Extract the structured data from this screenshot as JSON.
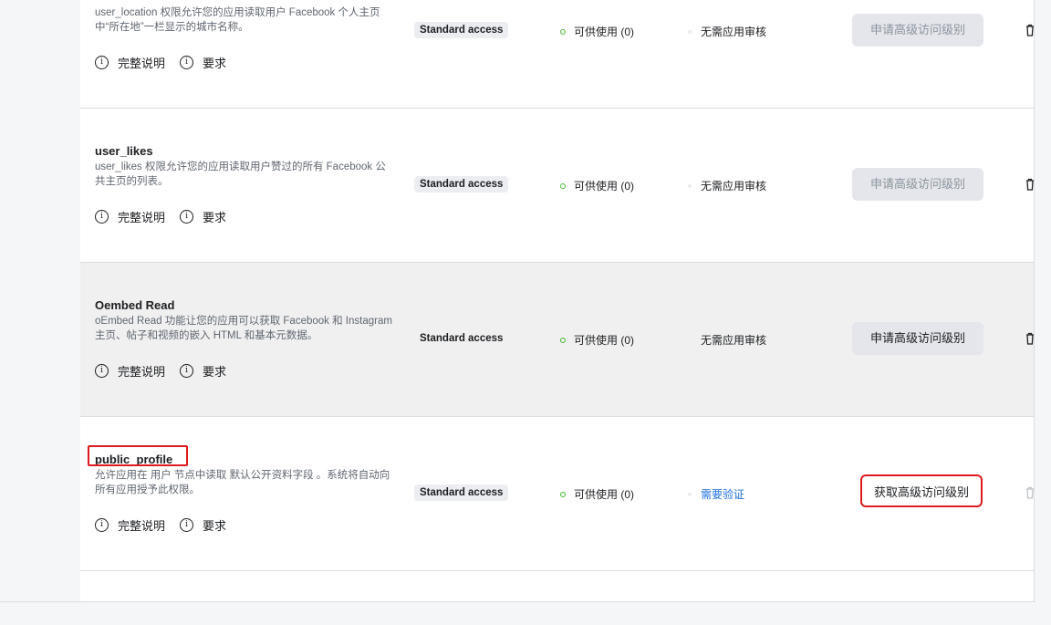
{
  "permissions": [
    {
      "title": "",
      "description": "user_location 权限允许您的应用读取用户 Facebook 个人主页中“所在地”一栏显示的城市名称。",
      "access_level": "Standard access",
      "status": "可供使用 (0)",
      "review": "无需应用审核",
      "action": "申请高级访问级别",
      "action_state": "disabled"
    },
    {
      "title": "user_likes",
      "description": "user_likes 权限允许您的应用读取用户赞过的所有 Facebook 公共主页的列表。",
      "access_level": "Standard access",
      "status": "可供使用 (0)",
      "review": "无需应用审核",
      "action": "申请高级访问级别",
      "action_state": "disabled"
    },
    {
      "title": "Oembed Read",
      "description": "oEmbed Read 功能让您的应用可以获取 Facebook 和 Instagram 主页、帖子和视频的嵌入 HTML 和基本元数据。",
      "access_level": "Standard access",
      "status": "可供使用 (0)",
      "review": "无需应用审核",
      "action": "申请高级访问级别",
      "action_state": "enabled"
    },
    {
      "title": "public_profile",
      "description": "允许应用在 用户 节点中读取 默认公开资料字段 。系统将自动向所有应用授予此权限。",
      "access_level": "Standard access",
      "status": "可供使用 (0)",
      "review": "需要验证",
      "action": "获取高级访问级别",
      "action_state": "highlighted"
    }
  ],
  "links": {
    "details": "完整说明",
    "requirements": "要求"
  },
  "colors": {
    "status_dot": "#42b72a",
    "link": "#216fdb",
    "highlight": "#e0191e",
    "button_bg": "#e4e6eb"
  }
}
